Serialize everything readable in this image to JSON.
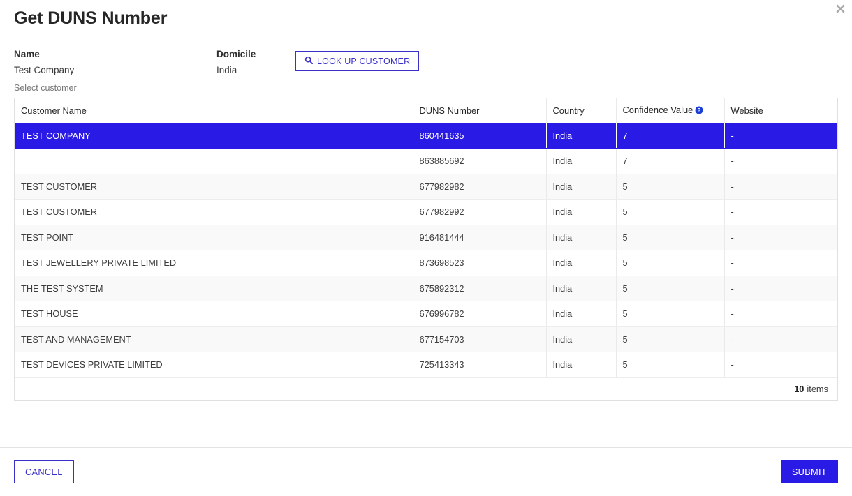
{
  "dialog": {
    "title": "Get DUNS Number",
    "close_label": "✖",
    "close_icon": "close-icon"
  },
  "details": {
    "name_label": "Name",
    "name_value": "Test Company",
    "domicile_label": "Domicile",
    "domicile_value": "India",
    "lookup_button_label": "LOOK UP CUSTOMER",
    "lookup_button_icon": "search-icon",
    "select_hint": "Select customer"
  },
  "table": {
    "columns": [
      {
        "key": "customer",
        "label": "Customer Name"
      },
      {
        "key": "duns",
        "label": "DUNS Number"
      },
      {
        "key": "country",
        "label": "Country"
      },
      {
        "key": "confidence",
        "label": "Confidence Value",
        "help_icon": "help-circle-icon"
      },
      {
        "key": "website",
        "label": "Website"
      }
    ],
    "rows": [
      {
        "customer": "TEST COMPANY",
        "duns": "860441635",
        "country": "India",
        "confidence": "7",
        "website": "-",
        "selected": true
      },
      {
        "customer": "",
        "duns": "863885692",
        "country": "India",
        "confidence": "7",
        "website": "-",
        "selected": false
      },
      {
        "customer": "TEST CUSTOMER",
        "duns": "677982982",
        "country": "India",
        "confidence": "5",
        "website": "-",
        "selected": false
      },
      {
        "customer": "TEST CUSTOMER",
        "duns": "677982992",
        "country": "India",
        "confidence": "5",
        "website": "-",
        "selected": false
      },
      {
        "customer": "TEST POINT",
        "duns": "916481444",
        "country": "India",
        "confidence": "5",
        "website": "-",
        "selected": false
      },
      {
        "customer": "TEST JEWELLERY PRIVATE LIMITED",
        "duns": "873698523",
        "country": "India",
        "confidence": "5",
        "website": "-",
        "selected": false
      },
      {
        "customer": "THE TEST SYSTEM",
        "duns": "675892312",
        "country": "India",
        "confidence": "5",
        "website": "-",
        "selected": false
      },
      {
        "customer": "TEST HOUSE",
        "duns": "676996782",
        "country": "India",
        "confidence": "5",
        "website": "-",
        "selected": false
      },
      {
        "customer": "TEST AND MANAGEMENT",
        "duns": "677154703",
        "country": "India",
        "confidence": "5",
        "website": "-",
        "selected": false
      },
      {
        "customer": "TEST DEVICES PRIVATE LIMITED",
        "duns": "725413343",
        "country": "India",
        "confidence": "5",
        "website": "-",
        "selected": false
      }
    ],
    "footer_count": "10",
    "footer_unit": "items"
  },
  "footer": {
    "cancel_label": "CANCEL",
    "submit_label": "SUBMIT"
  },
  "colors": {
    "accent": "#2a1ae5",
    "link": "#3b2fc9",
    "selected_row": "#2a1ae5",
    "alt_row": "#f9f9f9",
    "border": "#e0e0e0"
  }
}
